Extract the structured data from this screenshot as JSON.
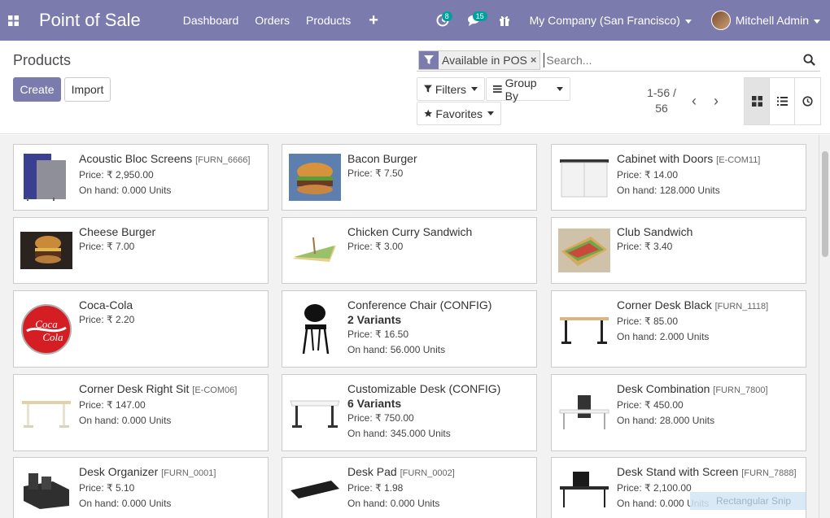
{
  "nav": {
    "app_title": "Point of Sale",
    "menu": [
      "Dashboard",
      "Orders",
      "Products"
    ],
    "plus": "+",
    "activity_badge": "8",
    "messages_badge": "15",
    "company": "My Company (San Francisco)",
    "user": "Mitchell Admin",
    "color": "#7c7bad"
  },
  "control": {
    "breadcrumb": "Products",
    "create_label": "Create",
    "import_label": "Import",
    "facet_label": "Available in POS",
    "facet_remove": "×",
    "search_placeholder": "Search...",
    "filters_label": "Filters",
    "groupby_label": "Group By",
    "favorites_label": "Favorites",
    "pager_line1": "1-56 /",
    "pager_line2": "56",
    "prev": "‹",
    "next": "›"
  },
  "products": [
    {
      "name": "Acoustic Bloc Screens",
      "ref": "[FURN_6666]",
      "price": "Price: ₹ 2,950.00",
      "onhand": "On hand: 0.000 Units",
      "variants": "",
      "image": "acoustic-screen"
    },
    {
      "name": "Bacon Burger",
      "ref": "",
      "price": "Price: ₹ 7.50",
      "onhand": "",
      "variants": "",
      "image": "burger"
    },
    {
      "name": "Cabinet with Doors",
      "ref": "[E-COM11]",
      "price": "Price: ₹ 14.00",
      "onhand": "On hand: 128.000 Units",
      "variants": "",
      "image": "cabinet"
    },
    {
      "name": "Cheese Burger",
      "ref": "",
      "price": "Price: ₹ 7.00",
      "onhand": "",
      "variants": "",
      "image": "cheese-burger"
    },
    {
      "name": "Chicken Curry Sandwich",
      "ref": "",
      "price": "Price: ₹ 3.00",
      "onhand": "",
      "variants": "",
      "image": "sandwich"
    },
    {
      "name": "Club Sandwich",
      "ref": "",
      "price": "Price: ₹ 3.40",
      "onhand": "",
      "variants": "",
      "image": "club-sandwich"
    },
    {
      "name": "Coca-Cola",
      "ref": "",
      "price": "Price: ₹ 2.20",
      "onhand": "",
      "variants": "",
      "image": "coca-cola"
    },
    {
      "name": "Conference Chair (CONFIG)",
      "ref": "",
      "price": "Price: ₹ 16.50",
      "onhand": "On hand: 56.000 Units",
      "variants": "2 Variants",
      "image": "chair"
    },
    {
      "name": "Corner Desk Black",
      "ref": "[FURN_1118]",
      "price": "Price: ₹ 85.00",
      "onhand": "On hand: 2.000 Units",
      "variants": "",
      "image": "desk"
    },
    {
      "name": "Corner Desk Right Sit",
      "ref": "[E-COM06]",
      "price": "Price: ₹ 147.00",
      "onhand": "On hand: 0.000 Units",
      "variants": "",
      "image": "desk-light"
    },
    {
      "name": "Customizable Desk (CONFIG)",
      "ref": "",
      "price": "Price: ₹ 750.00",
      "onhand": "On hand: 345.000 Units",
      "variants": "6 Variants",
      "image": "desk-white"
    },
    {
      "name": "Desk Combination",
      "ref": "[FURN_7800]",
      "price": "Price: ₹ 450.00",
      "onhand": "On hand: 28.000 Units",
      "variants": "",
      "image": "desk-combo"
    },
    {
      "name": "Desk Organizer",
      "ref": "[FURN_0001]",
      "price": "Price: ₹ 5.10",
      "onhand": "On hand: 0.000 Units",
      "variants": "",
      "image": "organizer"
    },
    {
      "name": "Desk Pad",
      "ref": "[FURN_0002]",
      "price": "Price: ₹ 1.98",
      "onhand": "On hand: 0.000 Units",
      "variants": "",
      "image": "desk-pad"
    },
    {
      "name": "Desk Stand with Screen",
      "ref": "[FURN_7888]",
      "price": "Price: ₹ 2,100.00",
      "onhand": "On hand: 0.000 Units",
      "variants": "",
      "image": "desk-stand"
    }
  ],
  "overlay": {
    "snip_label": "Rectangular Snip"
  }
}
